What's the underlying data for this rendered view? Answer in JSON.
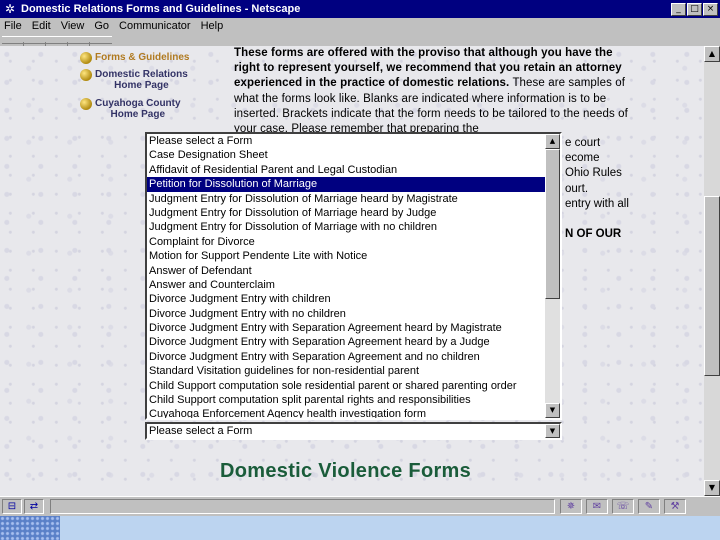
{
  "window": {
    "title": "Domestic Relations Forms and Guidelines - Netscape",
    "controls": {
      "minimize": "_",
      "maximize": "□",
      "close": "×"
    }
  },
  "menu": {
    "items": [
      "File",
      "Edit",
      "View",
      "Go",
      "Communicator",
      "Help"
    ]
  },
  "nav": {
    "items": [
      {
        "label": "Forms & Guidelines",
        "active": true
      },
      {
        "label_line1": "Domestic Relations",
        "label_line2": "Home Page"
      },
      {
        "label_line1": "Cuyahoga County",
        "label_line2": "Home Page"
      }
    ]
  },
  "intro": {
    "bold": "These forms are offered with the proviso that although you have the right to represent yourself, we recommend that you retain an attorney experienced in the practice of domestic relations.",
    "normal": "These are samples of what the forms look like. Blanks are indicated where information is to be inserted. Brackets indicate that the form needs to be tailored to the needs of your case. Please remember that preparing the",
    "tail_lines": [
      "e court",
      "ecome",
      "Ohio Rules",
      "ourt.",
      "entry with all"
    ],
    "tail_bold": "N OF OUR"
  },
  "form_list": {
    "selected_index": 3,
    "options": [
      "Please select a Form",
      "Case Designation Sheet",
      "Affidavit of Residential Parent and Legal Custodian",
      "Petition for Dissolution of Marriage",
      "Judgment Entry for Dissolution of Marriage heard by Magistrate",
      "Judgment Entry for Dissolution of Marriage heard by Judge",
      "Judgment Entry for Dissolution of Marriage with no children",
      "Complaint for Divorce",
      "Motion for Support Pendente Lite with Notice",
      "Answer of Defendant",
      "Answer and Counterclaim",
      "Divorce Judgment Entry with children",
      "Divorce Judgment Entry with no children",
      "Divorce Judgment Entry with Separation Agreement heard by Magistrate",
      "Divorce Judgment Entry with Separation Agreement heard by a Judge",
      "Divorce Judgment Entry with Separation Agreement and no children",
      "Standard Visitation guidelines for non-residential parent",
      "Child Support computation sole residential parent or shared parenting order",
      "Child Support computation split parental rights and responsibilities",
      "Cuyahoga Enforcement Agency health investigation form"
    ]
  },
  "form_dropdown": {
    "value": "Please select a Form"
  },
  "section": {
    "heading": "Domestic Violence Forms"
  },
  "icons": {
    "app": "netscape-icon",
    "status_left": [
      "security-icon",
      "connection-icon"
    ],
    "status_right": [
      "navigator-icon",
      "mail-icon",
      "discussion-icon",
      "composer-icon",
      "component-icon"
    ]
  }
}
